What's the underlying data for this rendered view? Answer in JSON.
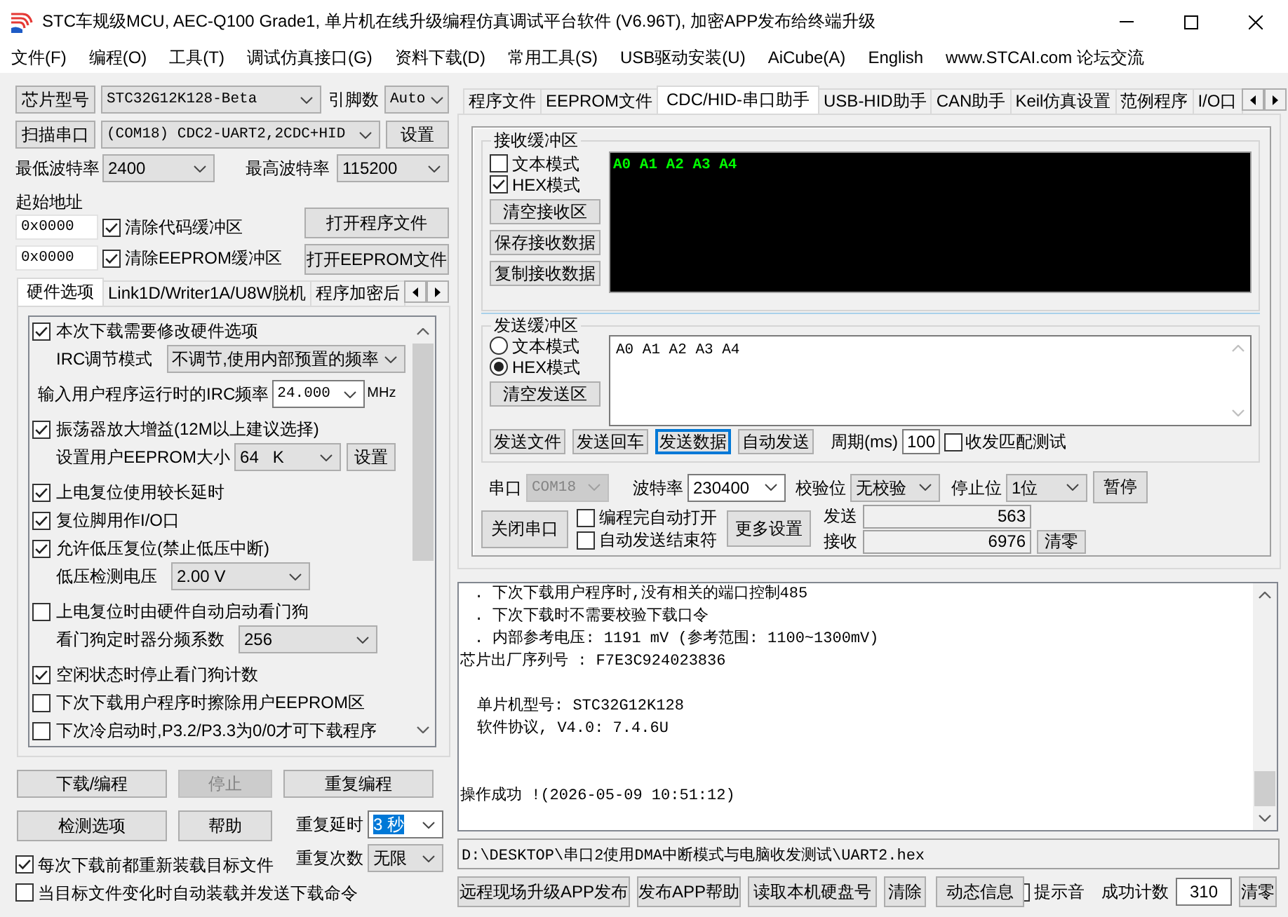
{
  "window": {
    "title": "STC车规级MCU, AEC-Q100 Grade1, 单片机在线升级编程仿真调试平台软件 (V6.96T), 加密APP发布给终端升级"
  },
  "menu": [
    "文件(F)",
    "编程(O)",
    "工具(T)",
    "调试仿真接口(G)",
    "资料下载(D)",
    "常用工具(S)",
    "USB驱动安装(U)",
    "AiCube(A)",
    "English",
    "www.STCAI.com 论坛交流"
  ],
  "chip": {
    "button": "芯片型号",
    "model": "STC32G12K128-Beta",
    "pins_label": "引脚数",
    "pins": "Auto"
  },
  "port": {
    "button": "扫描串口",
    "value": "(COM18) CDC2-UART2,2CDC+HID",
    "settings_button": "设置"
  },
  "baud": {
    "min_label": "最低波特率",
    "min": "2400",
    "max_label": "最高波特率",
    "max": "115200"
  },
  "start_address": {
    "label": "起始地址",
    "rows": [
      {
        "value": "0x0000",
        "clear_label": "清除代码缓冲区",
        "checked": true,
        "open_button": "打开程序文件"
      },
      {
        "value": "0x0000",
        "clear_label": "清除EEPROM缓冲区",
        "checked": true,
        "open_button": "打开EEPROM文件"
      }
    ]
  },
  "left_tabs": [
    {
      "label": "硬件选项",
      "selected": true
    },
    {
      "label": "Link1D/Writer1A/U8W脱机",
      "selected": false
    },
    {
      "label": "程序加密后",
      "selected": false
    }
  ],
  "hardware_options": [
    {
      "kind": "check",
      "label": "本次下载需要修改硬件选项",
      "checked": true
    },
    {
      "kind": "select",
      "label": "IRC调节模式",
      "value": "不调节,使用内部预置的频率"
    },
    {
      "kind": "input",
      "label": "输入用户程序运行时的IRC频率",
      "value": "24.000",
      "unit": "MHz"
    },
    {
      "kind": "check",
      "label": "振荡器放大增益(12M以上建议选择)",
      "checked": true
    },
    {
      "kind": "select",
      "label": "设置用户EEPROM大小",
      "value": "64   K",
      "button": "设置"
    },
    {
      "kind": "check",
      "label": "上电复位使用较长延时",
      "checked": true
    },
    {
      "kind": "check",
      "label": "复位脚用作I/O口",
      "checked": true
    },
    {
      "kind": "check",
      "label": "允许低压复位(禁止低压中断)",
      "checked": true
    },
    {
      "kind": "select",
      "label": "低压检测电压",
      "value": "2.00 V"
    },
    {
      "kind": "check",
      "label": "上电复位时由硬件自动启动看门狗",
      "checked": false
    },
    {
      "kind": "select",
      "label": "看门狗定时器分频系数",
      "value": "256"
    },
    {
      "kind": "check",
      "label": "空闲状态时停止看门狗计数",
      "checked": true
    },
    {
      "kind": "check",
      "label": "下次下载用户程序时擦除用户EEPROM区",
      "checked": false
    },
    {
      "kind": "check",
      "label": "下次冷启动时,P3.2/P3.3为0/0才可下载程序",
      "checked": false
    }
  ],
  "actions": {
    "buttons": [
      {
        "label": "下载/编程",
        "disabled": false
      },
      {
        "label": "停止",
        "disabled": true
      },
      {
        "label": "重复编程",
        "disabled": false
      },
      {
        "label": "检测选项",
        "disabled": false
      },
      {
        "label": "帮助",
        "disabled": false
      }
    ],
    "repeat_delay": {
      "label": "重复延时",
      "value": "3 秒",
      "highlighted": true
    },
    "repeat_count": {
      "label": "重复次数",
      "value": "无限"
    }
  },
  "reload_options": [
    {
      "label": "每次下载前都重新装载目标文件",
      "checked": true
    },
    {
      "label": "当目标文件变化时自动装载并发送下载命令",
      "checked": false
    }
  ],
  "right_tabs": [
    {
      "label": "程序文件",
      "selected": false
    },
    {
      "label": "EEPROM文件",
      "selected": false
    },
    {
      "label": "CDC/HID-串口助手",
      "selected": true
    },
    {
      "label": "USB-HID助手",
      "selected": false
    },
    {
      "label": "CAN助手",
      "selected": false
    },
    {
      "label": "Keil仿真设置",
      "selected": false
    },
    {
      "label": "范例程序",
      "selected": false
    },
    {
      "label": "I/O口",
      "selected": false
    }
  ],
  "serial_assistant": {
    "receive": {
      "title": "接收缓冲区",
      "modes": [
        {
          "label": "文本模式",
          "checked": false
        },
        {
          "label": "HEX模式",
          "checked": true
        }
      ],
      "buttons": [
        "清空接收区",
        "保存接收数据",
        "复制接收数据"
      ],
      "data": "A0 A1 A2 A3 A4"
    },
    "send": {
      "title": "发送缓冲区",
      "modes": [
        {
          "label": "文本模式",
          "selected": false
        },
        {
          "label": "HEX模式",
          "selected": true
        }
      ],
      "clear_button": "清空发送区",
      "data": "A0 A1 A2 A3 A4"
    },
    "send_buttons": [
      {
        "label": "发送文件",
        "focused": false
      },
      {
        "label": "发送回车",
        "focused": false
      },
      {
        "label": "发送数据",
        "focused": true
      },
      {
        "label": "自动发送",
        "focused": false
      }
    ],
    "period": {
      "label": "周期(ms)",
      "value": "100"
    },
    "match_test": {
      "label": "收发匹配测试",
      "checked": false
    },
    "port": {
      "label": "串口",
      "value": "COM18",
      "disabled": true
    },
    "baud": {
      "label": "波特率",
      "value": "230400"
    },
    "parity": {
      "label": "校验位",
      "value": "无校验"
    },
    "stop_bits": {
      "label": "停止位",
      "value": "1位"
    },
    "pause_button": "暂停",
    "close_port_button": "关闭串口",
    "auto_options": [
      {
        "label": "编程完自动打开",
        "checked": false
      },
      {
        "label": "自动发送结束符",
        "checked": false
      }
    ],
    "more_settings_button": "更多设置",
    "counters": [
      {
        "label": "发送",
        "value": "563"
      },
      {
        "label": "接收",
        "value": "6976"
      }
    ],
    "clear_button": "清零"
  },
  "log": {
    "lines": [
      {
        "kind": "bullet",
        "text": ". 下次下载用户程序时,没有相关的端口控制485"
      },
      {
        "kind": "bullet",
        "text": ". 下次下载时不需要校验下载口令"
      },
      {
        "kind": "bullet",
        "text": ". 内部参考电压: 1191 mV (参考范围: 1100~1300mV)"
      },
      {
        "kind": "plain",
        "text": "芯片出厂序列号 : F7E3C924023836"
      },
      {
        "kind": "blank"
      },
      {
        "kind": "detail",
        "text": "单片机型号: STC32G12K128"
      },
      {
        "kind": "detail",
        "text": "软件协议, V4.0: 7.4.6U"
      },
      {
        "kind": "blank"
      },
      {
        "kind": "blank"
      },
      {
        "kind": "plain",
        "text": "操作成功 !(2026-05-09 10:51:12)"
      }
    ]
  },
  "file_path": "D:\\DESKTOP\\串口2使用DMA中断模式与电脑收发测试\\UART2.hex",
  "bottom_bar": {
    "buttons": [
      "远程现场升级APP发布",
      "发布APP帮助",
      "读取本机硬盘号",
      "清除",
      "动态信息"
    ],
    "sound_checked": false,
    "sound_label": "提示音",
    "success_label": "成功计数",
    "success_count": "310",
    "clear_button": "清零"
  }
}
